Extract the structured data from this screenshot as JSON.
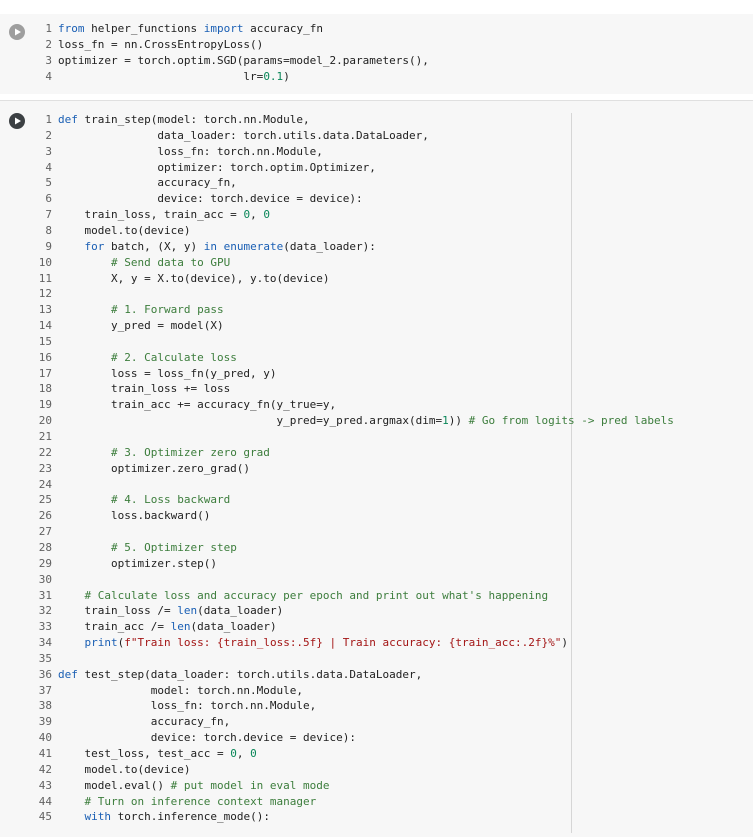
{
  "cell1": {
    "lines": [
      {
        "n": "1",
        "text": "from helper_functions import accuracy_fn"
      },
      {
        "n": "2",
        "text": "loss_fn = nn.CrossEntropyLoss()"
      },
      {
        "n": "3",
        "text": "optimizer = torch.optim.SGD(params=model_2.parameters(),"
      },
      {
        "n": "4",
        "text": "                            lr=0.1)"
      }
    ]
  },
  "cell2": {
    "lines": [
      {
        "n": "1",
        "text": "def train_step(model: torch.nn.Module,"
      },
      {
        "n": "2",
        "text": "               data_loader: torch.utils.data.DataLoader,"
      },
      {
        "n": "3",
        "text": "               loss_fn: torch.nn.Module,"
      },
      {
        "n": "4",
        "text": "               optimizer: torch.optim.Optimizer,"
      },
      {
        "n": "5",
        "text": "               accuracy_fn,"
      },
      {
        "n": "6",
        "text": "               device: torch.device = device):"
      },
      {
        "n": "7",
        "text": "    train_loss, train_acc = 0, 0"
      },
      {
        "n": "8",
        "text": "    model.to(device)"
      },
      {
        "n": "9",
        "text": "    for batch, (X, y) in enumerate(data_loader):"
      },
      {
        "n": "10",
        "text": "        # Send data to GPU"
      },
      {
        "n": "11",
        "text": "        X, y = X.to(device), y.to(device)"
      },
      {
        "n": "12",
        "text": ""
      },
      {
        "n": "13",
        "text": "        # 1. Forward pass"
      },
      {
        "n": "14",
        "text": "        y_pred = model(X)"
      },
      {
        "n": "15",
        "text": ""
      },
      {
        "n": "16",
        "text": "        # 2. Calculate loss"
      },
      {
        "n": "17",
        "text": "        loss = loss_fn(y_pred, y)"
      },
      {
        "n": "18",
        "text": "        train_loss += loss"
      },
      {
        "n": "19",
        "text": "        train_acc += accuracy_fn(y_true=y,"
      },
      {
        "n": "20",
        "text": "                                 y_pred=y_pred.argmax(dim=1)) # Go from logits -> pred labels"
      },
      {
        "n": "21",
        "text": ""
      },
      {
        "n": "22",
        "text": "        # 3. Optimizer zero grad"
      },
      {
        "n": "23",
        "text": "        optimizer.zero_grad()"
      },
      {
        "n": "24",
        "text": ""
      },
      {
        "n": "25",
        "text": "        # 4. Loss backward"
      },
      {
        "n": "26",
        "text": "        loss.backward()"
      },
      {
        "n": "27",
        "text": ""
      },
      {
        "n": "28",
        "text": "        # 5. Optimizer step"
      },
      {
        "n": "29",
        "text": "        optimizer.step()"
      },
      {
        "n": "30",
        "text": ""
      },
      {
        "n": "31",
        "text": "    # Calculate loss and accuracy per epoch and print out what's happening"
      },
      {
        "n": "32",
        "text": "    train_loss /= len(data_loader)"
      },
      {
        "n": "33",
        "text": "    train_acc /= len(data_loader)"
      },
      {
        "n": "34",
        "text": "    print(f\"Train loss: {train_loss:.5f} | Train accuracy: {train_acc:.2f}%\")"
      },
      {
        "n": "35",
        "text": ""
      },
      {
        "n": "36",
        "text": "def test_step(data_loader: torch.utils.data.DataLoader,"
      },
      {
        "n": "37",
        "text": "              model: torch.nn.Module,"
      },
      {
        "n": "38",
        "text": "              loss_fn: torch.nn.Module,"
      },
      {
        "n": "39",
        "text": "              accuracy_fn,"
      },
      {
        "n": "40",
        "text": "              device: torch.device = device):"
      },
      {
        "n": "41",
        "text": "    test_loss, test_acc = 0, 0"
      },
      {
        "n": "42",
        "text": "    model.to(device)"
      },
      {
        "n": "43",
        "text": "    model.eval() # put model in eval mode"
      },
      {
        "n": "44",
        "text": "    # Turn on inference context manager"
      },
      {
        "n": "45",
        "text": "    with torch.inference_mode():"
      }
    ]
  }
}
